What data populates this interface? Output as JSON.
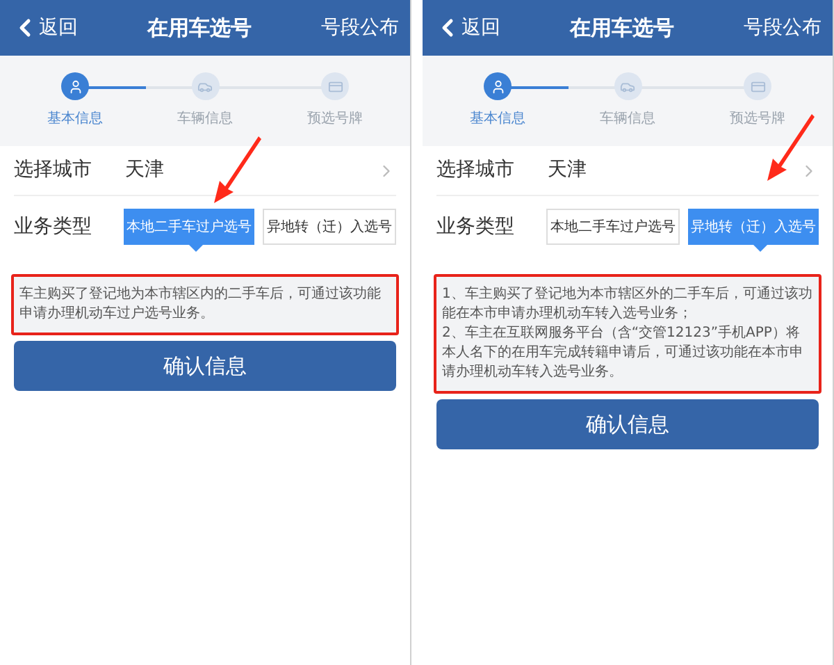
{
  "screens": [
    {
      "header": {
        "back": "返回",
        "title": "在用车选号",
        "action": "号段公布"
      },
      "steps": [
        {
          "label": "基本信息",
          "selected": true
        },
        {
          "label": "车辆信息",
          "selected": false
        },
        {
          "label": "预选号牌",
          "selected": false
        }
      ],
      "city": {
        "label": "选择城市",
        "value": "天津"
      },
      "business": {
        "label": "业务类型",
        "options": [
          {
            "label": "本地二手车过户选号",
            "selected": true
          },
          {
            "label": "异地转（迁）入选号",
            "selected": false
          }
        ]
      },
      "notes": [
        "车主购买了登记地为本市辖区内的二手车后，可通过该功能申请办理机动车过户选号业务。"
      ],
      "confirm": "确认信息"
    },
    {
      "header": {
        "back": "返回",
        "title": "在用车选号",
        "action": "号段公布"
      },
      "steps": [
        {
          "label": "基本信息",
          "selected": true
        },
        {
          "label": "车辆信息",
          "selected": false
        },
        {
          "label": "预选号牌",
          "selected": false
        }
      ],
      "city": {
        "label": "选择城市",
        "value": "天津"
      },
      "business": {
        "label": "业务类型",
        "options": [
          {
            "label": "本地二手车过户选号",
            "selected": false
          },
          {
            "label": "异地转（迁）入选号",
            "selected": true
          }
        ]
      },
      "notes": [
        "1、车主购买了登记地为本市辖区外的二手车后，可通过该功能在本市申请办理机动车转入选号业务；",
        "2、车主在互联网服务平台（含“交管12123”手机APP）将本人名下的在用车完成转籍申请后，可通过该功能在本市申请办理机动车转入选号业务。"
      ],
      "confirm": "确认信息"
    }
  ]
}
